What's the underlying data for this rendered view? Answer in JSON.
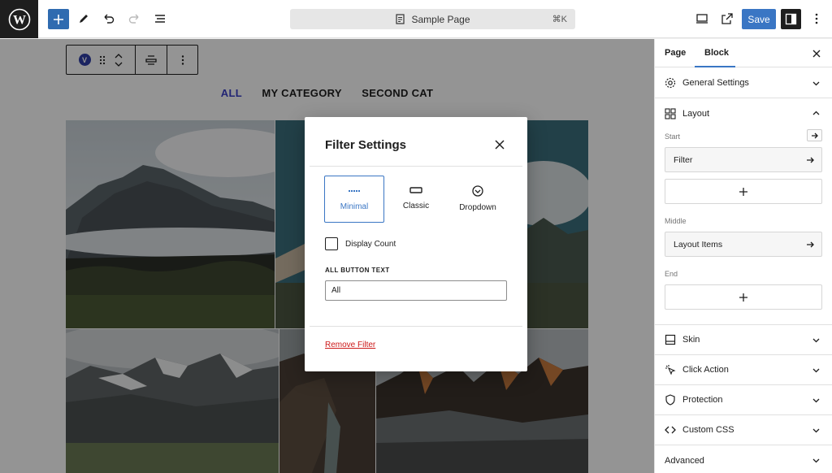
{
  "toolbar": {
    "doc_title": "Sample Page",
    "doc_shortcut": "⌘K",
    "save_label": "Save"
  },
  "block_toolbar": {
    "badge": "V"
  },
  "filters": [
    "ALL",
    "MY CATEGORY",
    "SECOND CAT"
  ],
  "active_filter": "ALL",
  "modal": {
    "title": "Filter Settings",
    "style_options": [
      {
        "label": "Minimal",
        "icon": "minimal-style-icon",
        "selected": true
      },
      {
        "label": "Classic",
        "icon": "classic-style-icon",
        "selected": false
      },
      {
        "label": "Dropdown",
        "icon": "dropdown-style-icon",
        "selected": false
      }
    ],
    "display_count_label": "Display Count",
    "display_count_checked": false,
    "all_button_text_label": "ALL BUTTON TEXT",
    "all_button_text_value": "All",
    "remove_filter_label": "Remove Filter"
  },
  "sidebar": {
    "tabs": [
      "Page",
      "Block"
    ],
    "active_tab": "Block",
    "general_settings": "General Settings",
    "layout": "Layout",
    "start_label": "Start",
    "start_item": "Filter",
    "middle_label": "Middle",
    "middle_item": "Layout Items",
    "end_label": "End",
    "skin": "Skin",
    "click_action": "Click Action",
    "protection": "Protection",
    "custom_css": "Custom CSS",
    "advanced": "Advanced"
  },
  "colors": {
    "accent": "#3a76c4",
    "active_filter": "#3a3fc9",
    "danger": "#cc1818",
    "dark": "#1e1e1e"
  }
}
